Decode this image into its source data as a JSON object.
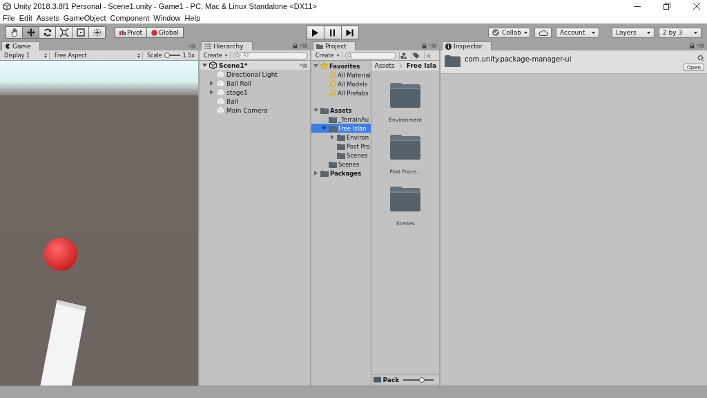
{
  "window": {
    "title": "Unity 2018.3.8f1 Personal - Scene1.unity - Game1 - PC, Mac & Linux Standalone <DX11>"
  },
  "menu": [
    "File",
    "Edit",
    "Assets",
    "GameObject",
    "Component",
    "Window",
    "Help"
  ],
  "toolbar": {
    "tools": [
      {
        "kind": "hand",
        "selected": false
      },
      {
        "kind": "move",
        "selected": true
      },
      {
        "kind": "rotate",
        "selected": false
      },
      {
        "kind": "scale",
        "selected": false
      },
      {
        "kind": "rect",
        "selected": false
      },
      {
        "kind": "transform",
        "selected": false
      }
    ],
    "pivot": "Pivot",
    "global": "Global",
    "play": [
      {
        "kind": "play"
      },
      {
        "kind": "pause"
      },
      {
        "kind": "step"
      }
    ],
    "collab": "Collab",
    "account": "Account",
    "layers": "Layers",
    "layout": "2 by 3"
  },
  "game": {
    "tab": "Game",
    "display": "Display 1",
    "aspect": "Free Aspect",
    "scale_label": "Scale",
    "scale": {
      "level": 0.15
    },
    "scale_value": "1.5x"
  },
  "hierarchy": {
    "tab": "Hierarchy",
    "create": "Create",
    "search_placeholder": "All",
    "scene": "Scene1*",
    "items": [
      {
        "label": "Directional Light"
      },
      {
        "label": "Ball Roll",
        "expanded": false
      },
      {
        "label": "stage1",
        "expanded": false
      },
      {
        "label": "Ball"
      },
      {
        "label": "Main Camera"
      }
    ]
  },
  "project": {
    "tab": "Project",
    "create": "Create",
    "tree": [
      {
        "label": "Favorites",
        "kind": "favorites",
        "expanded": true,
        "selected": false,
        "children": [
          {
            "label": "All Material",
            "kind": "search",
            "selected": false
          },
          {
            "label": "All Models",
            "kind": "search",
            "selected": false
          },
          {
            "label": "All Prefabs",
            "kind": "search",
            "selected": false
          }
        ]
      },
      {
        "label": "Assets",
        "kind": "root",
        "expanded": true,
        "selected": false,
        "children": [
          {
            "label": "_TerrainAu",
            "kind": "folder",
            "selected": false
          },
          {
            "label": "Free Islan",
            "kind": "folder",
            "expanded": true,
            "selected": true,
            "children": [
              {
                "label": "Environ",
                "kind": "folder",
                "expanded": false,
                "selected": false
              },
              {
                "label": "Post Pro",
                "kind": "folder",
                "selected": false
              },
              {
                "label": "Scenes",
                "kind": "folder",
                "selected": false
              }
            ]
          },
          {
            "label": "Scenes",
            "kind": "folder",
            "selected": false
          }
        ]
      },
      {
        "label": "Packages",
        "kind": "root",
        "expanded": false,
        "selected": false
      }
    ],
    "breadcrumb": [
      "Assets",
      "Free Isla"
    ],
    "grid": [
      "Environment",
      "Post Proce...",
      "Scenes"
    ],
    "footer_label": "Pack",
    "size": {
      "level": 0.6
    }
  },
  "inspector": {
    "tab": "Inspector",
    "name": "com.unity.package-manager-ui",
    "open": "Open"
  }
}
